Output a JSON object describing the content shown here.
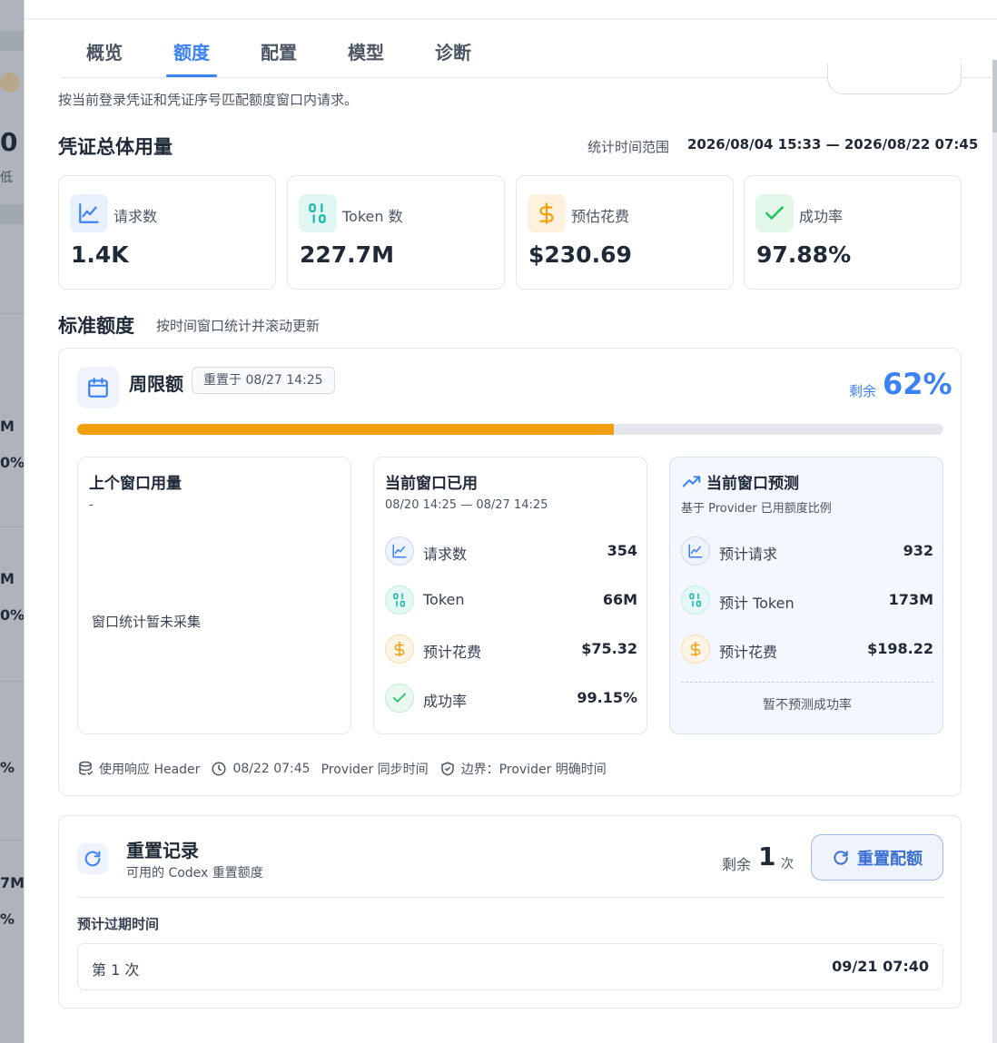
{
  "background": {
    "fragments": [
      "0",
      "低",
      "M",
      "0%",
      "M",
      "0%",
      "",
      "%",
      "7M",
      "%"
    ]
  },
  "tabs": [
    {
      "label": "概览"
    },
    {
      "label": "额度"
    },
    {
      "label": "配置"
    },
    {
      "label": "模型"
    },
    {
      "label": "诊断"
    }
  ],
  "active_tab": "额度",
  "description": "按当前登录凭证和凭证序号匹配额度窗口内请求。",
  "usage": {
    "title": "凭证总体用量",
    "range_label": "统计时间范围",
    "range_value": "2026/08/04 15:33 — 2026/08/22 07:45",
    "stats": [
      {
        "icon": "chart-line-icon",
        "label": "请求数",
        "value": "1.4K"
      },
      {
        "icon": "binary-icon",
        "label": "Token 数",
        "value": "227.7M"
      },
      {
        "icon": "dollar-icon",
        "label": "预估花费",
        "value": "$230.69"
      },
      {
        "icon": "check-icon",
        "label": "成功率",
        "value": "97.88%"
      }
    ]
  },
  "standard": {
    "title": "标准额度",
    "subtitle": "按时间窗口统计并滚动更新",
    "weekly": {
      "title": "周限额",
      "reset_chip": "重置于 08/27 14:25",
      "remain_label": "剩余",
      "remain_pct": "62%",
      "used_fraction": 0.62
    },
    "previous": {
      "title": "上个窗口用量",
      "range": "-",
      "empty": "窗口统计暂未采集"
    },
    "current": {
      "title": "当前窗口已用",
      "range": "08/20 14:25 — 08/27 14:25",
      "rows": [
        {
          "icon": "chart-line-icon",
          "label": "请求数",
          "value": "354"
        },
        {
          "icon": "binary-icon",
          "label": "Token",
          "value": "66M"
        },
        {
          "icon": "dollar-icon",
          "label": "预计花费",
          "value": "$75.32"
        },
        {
          "icon": "check-icon",
          "label": "成功率",
          "value": "99.15%"
        }
      ]
    },
    "forecast": {
      "title": "当前窗口预测",
      "range": "基于 Provider 已用额度比例",
      "rows": [
        {
          "icon": "chart-line-icon",
          "label": "预计请求",
          "value": "932"
        },
        {
          "icon": "binary-icon",
          "label": "预计 Token",
          "value": "173M"
        },
        {
          "icon": "dollar-icon",
          "label": "预计花费",
          "value": "$198.22"
        }
      ],
      "note": "暂不预测成功率"
    },
    "footer": {
      "source": "使用响应 Header",
      "time": "08/22 07:45",
      "time_desc": "Provider 同步时间",
      "boundary": "边界：Provider 明确时间"
    }
  },
  "reset_record": {
    "title": "重置记录",
    "subtitle": "可用的 Codex 重置额度",
    "remain_label": "剩余",
    "remain_count": "1",
    "remain_unit": "次",
    "button_label": "重置配额",
    "expire_label": "预计过期时间",
    "entries": [
      {
        "name": "第 1 次",
        "time": "09/21 07:40"
      }
    ]
  },
  "colors": {
    "accent": "#3b82f6",
    "progress": "#f29d0c",
    "teal": "#14b8a6",
    "amber": "#f59e0b",
    "green": "#22c55e"
  }
}
